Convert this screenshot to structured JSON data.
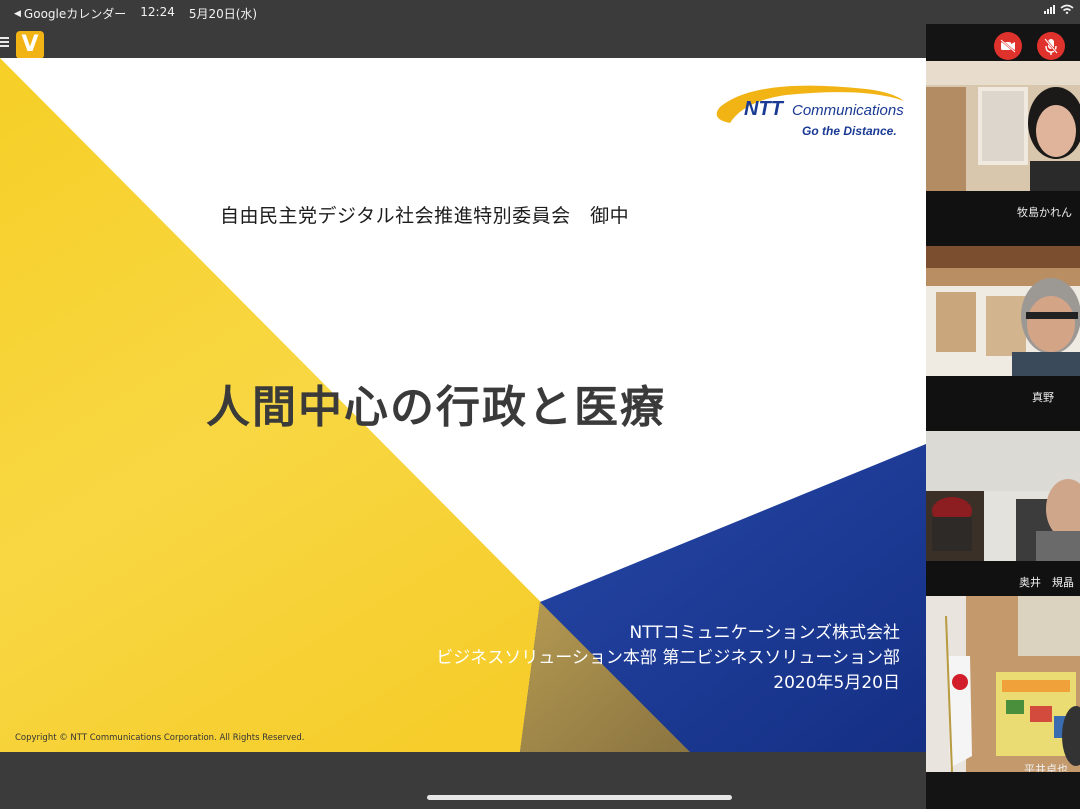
{
  "status_bar": {
    "back_app": "Googleカレンダー",
    "time": "12:24",
    "date": "5月20日(水)"
  },
  "toolbar": {
    "menu_icon": "hamburger-menu-icon",
    "app_logo_letter": "V"
  },
  "slide": {
    "addressee": "自由民主党デジタル社会推進特別委員会　御中",
    "title": "人間中心の行政と医療",
    "logo": {
      "brand": "NTT Communications",
      "tagline": "Go the Distance."
    },
    "presenter": {
      "company": "NTTコミュニケーションズ株式会社",
      "department": "ビジネスソリューション本部 第二ビジネスソリューション部",
      "date": "2020年5月20日"
    },
    "copyright": "Copyright © NTT Communications Corporation. All Rights Reserved.",
    "colors": {
      "yellow": "#f7d02c",
      "blue": "#1a3a93"
    }
  },
  "participants": {
    "controls": {
      "video_icon": "video-off-icon",
      "mic_icon": "mic-off-icon",
      "color": "#e0322d"
    },
    "tiles": [
      {
        "name": "牧島かれん"
      },
      {
        "name": "真野"
      },
      {
        "name": "奥井　規晶"
      },
      {
        "name": "平井卓也"
      }
    ]
  }
}
